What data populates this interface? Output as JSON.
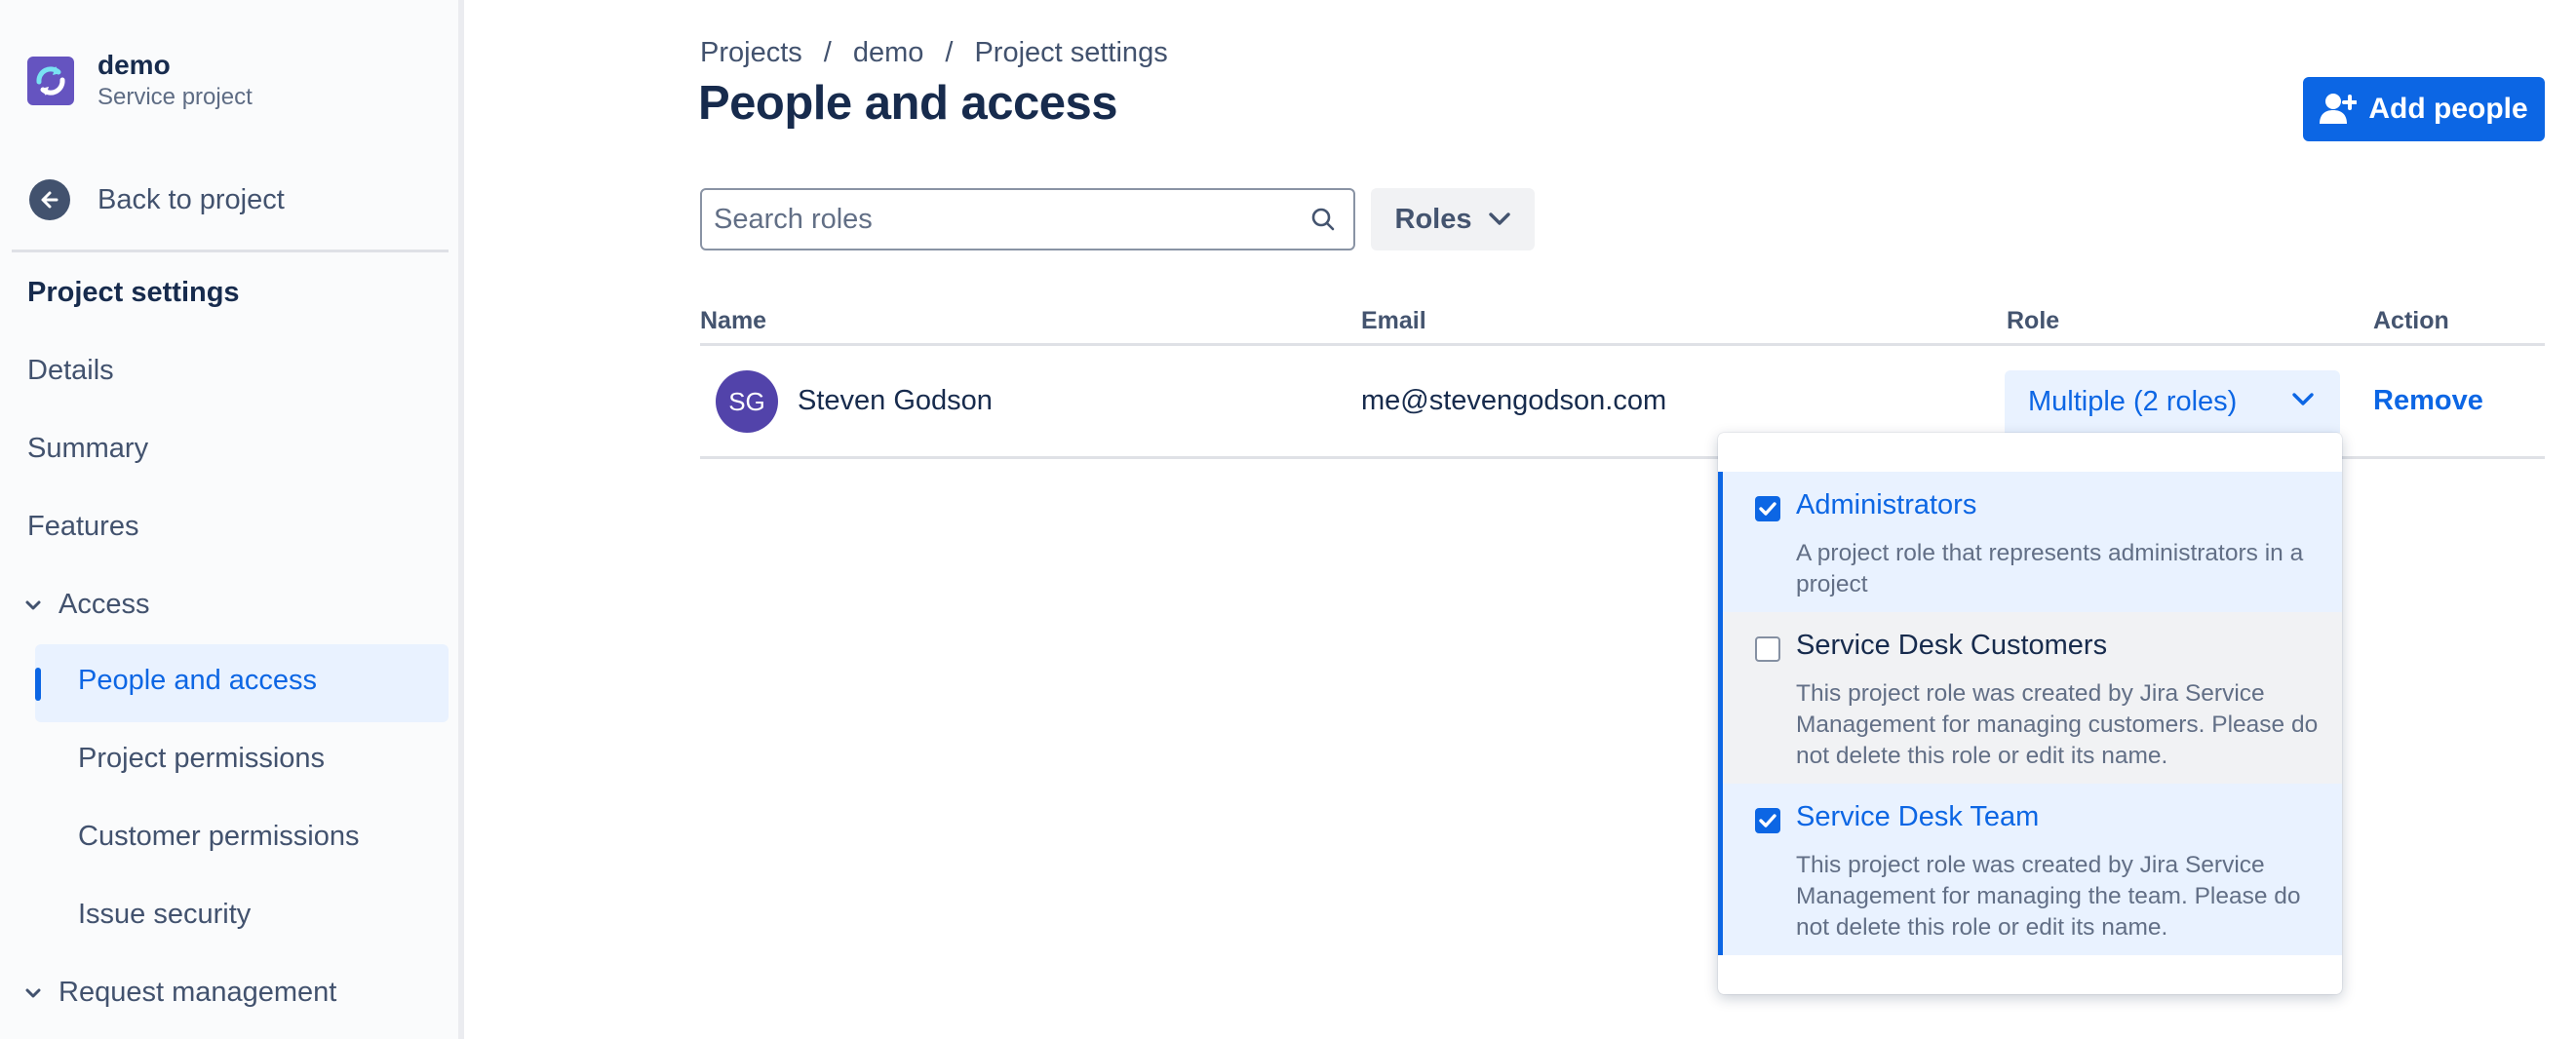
{
  "project": {
    "name": "demo",
    "type": "Service project",
    "logo_icon": "service-project-icon"
  },
  "sidebar": {
    "back_label": "Back to project",
    "heading": "Project settings",
    "items": [
      "Details",
      "Summary",
      "Features"
    ],
    "access_group": "Access",
    "access_items": {
      "active": "People and access",
      "others": [
        "Project permissions",
        "Customer permissions",
        "Issue security"
      ]
    },
    "request_group": "Request management"
  },
  "breadcrumb": [
    "Projects",
    "demo",
    "Project settings"
  ],
  "breadcrumb_separator": "/",
  "page_title": "People and access",
  "add_button": {
    "label": "Add people",
    "icon": "add-person-icon"
  },
  "search": {
    "placeholder": "Search roles",
    "value": ""
  },
  "roles_filter": {
    "label": "Roles"
  },
  "table": {
    "headers": [
      "Name",
      "Email",
      "Role",
      "Action"
    ],
    "rows": [
      {
        "initials": "SG",
        "name": "Steven Godson",
        "email": "me@stevengodson.com",
        "role": "Multiple (2 roles)",
        "action": "Remove"
      }
    ]
  },
  "role_menu": {
    "options": [
      {
        "title": "Administrators",
        "checked": true,
        "description": "A project role that represents administrators in a project"
      },
      {
        "title": "Service Desk Customers",
        "checked": false,
        "description": "This project role was created by Jira Service Management for managing customers. Please do not delete this role or edit its name."
      },
      {
        "title": "Service Desk Team",
        "checked": true,
        "description": "This project role was created by Jira Service Management for managing the team. Please do not delete this role or edit its name."
      }
    ]
  },
  "colors": {
    "primary": "#0c66e4",
    "selected_bg": "#e9f2ff",
    "avatar": "#5243aa",
    "project_logo": "#6554c0"
  }
}
